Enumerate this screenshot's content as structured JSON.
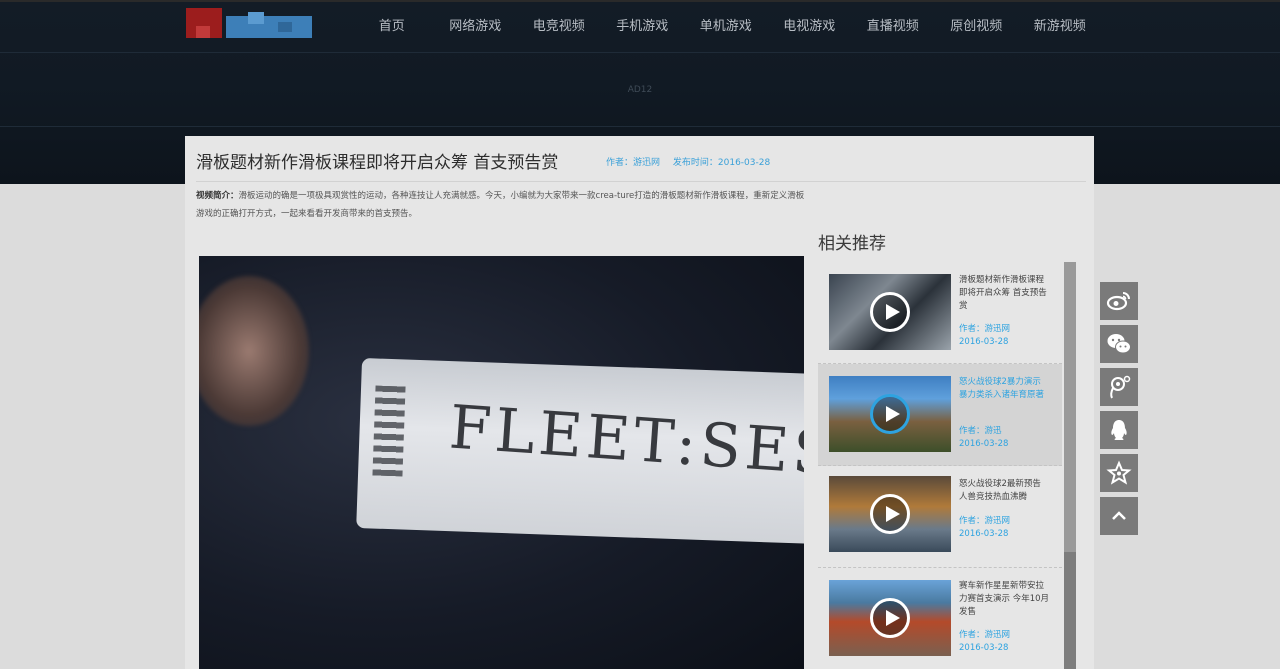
{
  "nav": [
    "首页",
    "网络游戏",
    "电竞视频",
    "手机游戏",
    "单机游戏",
    "电视游戏",
    "直播视频",
    "原创视频",
    "新游视频"
  ],
  "ad_label": "AD12",
  "article": {
    "title": "滑板题材新作滑板课程即将开启众筹 首支预告赏",
    "author": "作者：游迅网",
    "publish_time": "发布时间：2016-03-28",
    "intro_label": "视频简介：",
    "intro_text": "滑板运动的确是一项极具观赏性的运动，各种连技让人充满就感。今天，小编就为大家带来一款crea-ture打造的滑板题材新作滑板课程，重新定义滑板游戏的正确打开方式，一起来看看开发商带来的首支预告。"
  },
  "video": {
    "card_text": "FLEET:SES"
  },
  "recommend": {
    "title": "相关推荐",
    "items": [
      {
        "title": "滑板题材新作滑板课程即将开启众筹 首支预告赏",
        "author": "作者：游迅网",
        "date": "2016-03-28"
      },
      {
        "title": "怒火战役球2暴力演示 暴力类杀入诸年育原著",
        "author": "作者：游迅",
        "date": "2016-03-28"
      },
      {
        "title": "怒火战役球2最新预告 人兽竞技热血沸腾",
        "author": "作者：游迅网",
        "date": "2016-03-28"
      },
      {
        "title": "赛车新作星星新带安拉力赛首支演示 今年10月发售",
        "author": "作者：游迅网",
        "date": "2016-03-28"
      }
    ]
  },
  "share": [
    "weibo-icon",
    "wechat-icon",
    "tencent-weibo-icon",
    "qq-icon",
    "favorite-icon",
    "back-to-top-icon"
  ]
}
